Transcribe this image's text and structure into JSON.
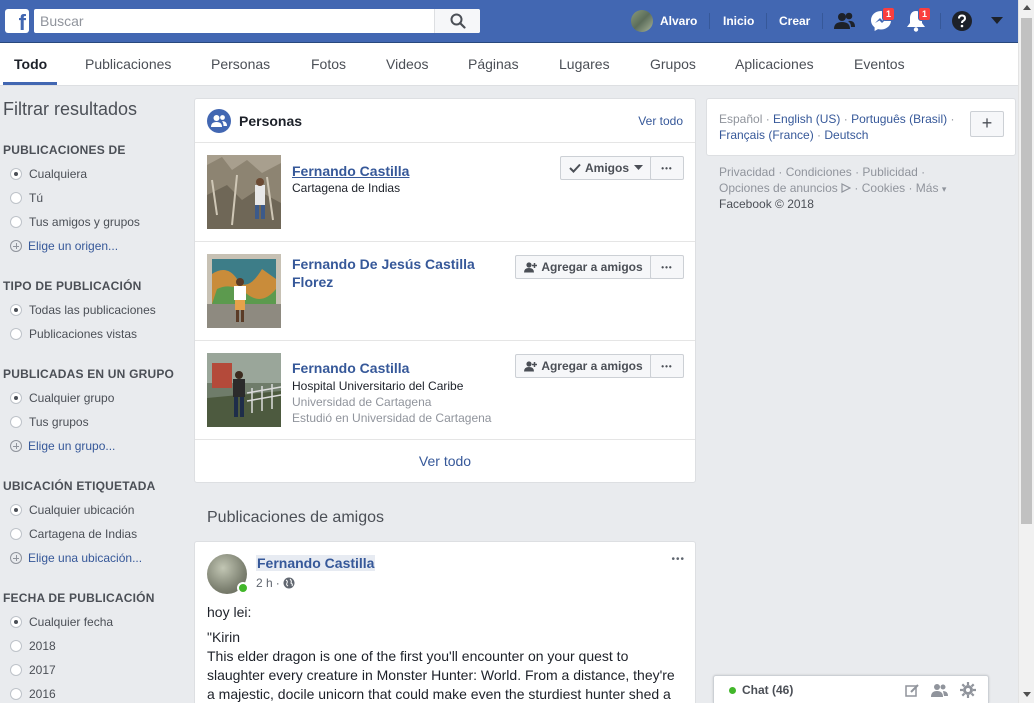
{
  "header": {
    "logo": "f",
    "search_placeholder": "Buscar",
    "user_name": "Alvaro",
    "inicio": "Inicio",
    "crear": "Crear",
    "messenger_badge": "1",
    "notifications_badge": "1"
  },
  "tabs": [
    {
      "label": "Todo"
    },
    {
      "label": "Publicaciones"
    },
    {
      "label": "Personas"
    },
    {
      "label": "Fotos"
    },
    {
      "label": "Videos"
    },
    {
      "label": "Páginas"
    },
    {
      "label": "Lugares"
    },
    {
      "label": "Grupos"
    },
    {
      "label": "Aplicaciones"
    },
    {
      "label": "Eventos"
    }
  ],
  "filters": {
    "title": "Filtrar resultados",
    "groups": [
      {
        "heading": "PUBLICACIONES DE",
        "options": [
          "Cualquiera",
          "Tú",
          "Tus amigos y grupos"
        ],
        "selected": 0,
        "add_link": "Elige un origen..."
      },
      {
        "heading": "TIPO DE PUBLICACIÓN",
        "options": [
          "Todas las publicaciones",
          "Publicaciones vistas"
        ],
        "selected": 0
      },
      {
        "heading": "PUBLICADAS EN UN GRUPO",
        "options": [
          "Cualquier grupo",
          "Tus grupos"
        ],
        "selected": 0,
        "add_link": "Elige un grupo..."
      },
      {
        "heading": "UBICACIÓN ETIQUETADA",
        "options": [
          "Cualquier ubicación",
          "Cartagena de Indias"
        ],
        "selected": 0,
        "add_link": "Elige una ubicación..."
      },
      {
        "heading": "FECHA DE PUBLICACIÓN",
        "options": [
          "Cualquier fecha",
          "2018",
          "2017",
          "2016"
        ],
        "selected": 0
      }
    ]
  },
  "people": {
    "title": "Personas",
    "see_all_top": "Ver todo",
    "see_all_bottom": "Ver todo",
    "results": [
      {
        "name": "Fernando Castilla",
        "lines": [
          "Cartagena de Indias"
        ],
        "grey_lines": [],
        "action": "Amigos",
        "more": "•••"
      },
      {
        "name": "Fernando De Jesús Castilla Florez",
        "lines": [],
        "grey_lines": [],
        "action": "Agregar a amigos",
        "more": "•••"
      },
      {
        "name": "Fernando Castilla",
        "lines": [
          "Hospital Universitario del Caribe"
        ],
        "grey_lines": [
          "Universidad de Cartagena",
          "Estudió en Universidad de Cartagena"
        ],
        "action": "Agregar a amigos",
        "more": "•••"
      }
    ]
  },
  "friends_posts": {
    "title": "Publicaciones de amigos",
    "post": {
      "author": "Fernando Castilla",
      "time": "2 h",
      "more": "•••",
      "line1": "hoy lei:",
      "line2": "\"Kirin",
      "body": "This elder dragon is one of the first you'll encounter on your quest to slaughter every creature in Monster Hunter: World. From a distance, they're a majestic, docile unicorn that could make even the sturdiest hunter shed a"
    }
  },
  "right": {
    "languages": {
      "current": "Español",
      "line1_links": [
        "English (US)",
        "Português (Brasil)"
      ],
      "line2_links": [
        "Français (France)",
        "Deutsch"
      ],
      "plus": "+"
    },
    "footer": {
      "line1": [
        "Privacidad",
        "Condiciones",
        "Publicidad"
      ],
      "line2": [
        "Opciones de anuncios",
        "Cookies",
        "Más"
      ],
      "copyright": "Facebook © 2018"
    }
  },
  "chat": {
    "label": "Chat (46)"
  },
  "colors": {
    "brand": "#4267b2",
    "link": "#365899",
    "badge": "#fa3e3e",
    "online": "#42b72a",
    "page_bg": "#e9ebee"
  }
}
